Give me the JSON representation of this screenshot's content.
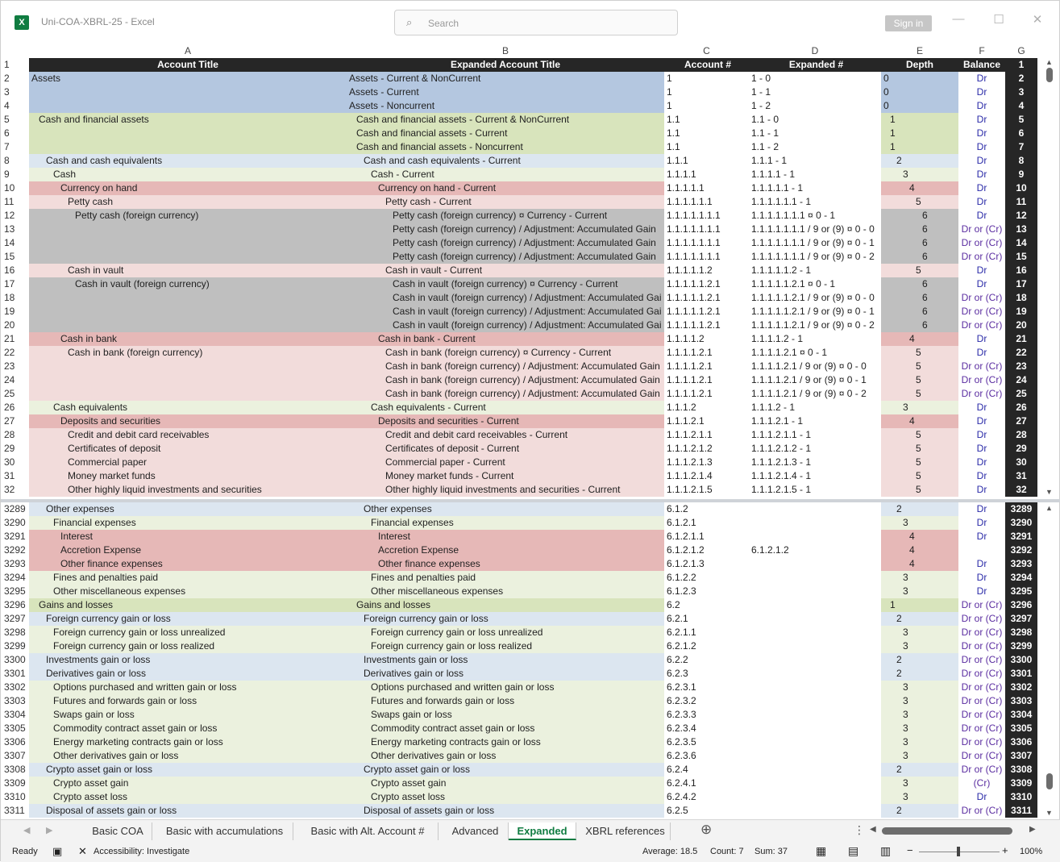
{
  "window": {
    "title": "Uni-COA-XBRL-25  -  Excel",
    "search_placeholder": "Search",
    "signin": "Sign in",
    "min": "—",
    "max": "☐",
    "close": "✕"
  },
  "col_letters": [
    "A",
    "B",
    "C",
    "D",
    "E",
    "F",
    "G"
  ],
  "headers": {
    "a": "Account Title",
    "b": "Expanded Account Title",
    "c": "Account #",
    "d": "Expanded #",
    "e": "Depth",
    "f": "Balance",
    "g": "1"
  },
  "palette": {
    "blue": "#b4c7e0",
    "green": "#d8e4bc",
    "lightblue": "#dce6f0",
    "lightgreen": "#ebf1de",
    "rose": "#e6b8b7",
    "pink": "#f2dcdb",
    "gray": "#bfbfbf"
  },
  "rows_top": [
    {
      "n": "2",
      "a": "Assets",
      "b": "Assets - Current & NonCurrent",
      "c": "1",
      "d": "1 - 0",
      "e": "0",
      "f": "Dr",
      "g": "2",
      "bg": "blue",
      "lvl": 0
    },
    {
      "n": "3",
      "a": "",
      "b": "Assets - Current",
      "c": "1",
      "d": "1 - 1",
      "e": "0",
      "f": "Dr",
      "g": "3",
      "bg": "blue",
      "lvl": 0
    },
    {
      "n": "4",
      "a": "",
      "b": "Assets - Noncurrent",
      "c": "1",
      "d": "1 - 2",
      "e": "0",
      "f": "Dr",
      "g": "4",
      "bg": "blue",
      "lvl": 0
    },
    {
      "n": "5",
      "a": "Cash and financial assets",
      "b": "Cash and financial assets - Current & NonCurrent",
      "c": "1.1",
      "d": "1.1 - 0",
      "e": "1",
      "f": "Dr",
      "g": "5",
      "bg": "green",
      "lvl": 1
    },
    {
      "n": "6",
      "a": "",
      "b": "Cash and financial assets - Current",
      "c": "1.1",
      "d": "1.1 - 1",
      "e": "1",
      "f": "Dr",
      "g": "6",
      "bg": "green",
      "lvl": 1
    },
    {
      "n": "7",
      "a": "",
      "b": "Cash and financial assets - Noncurrent",
      "c": "1.1",
      "d": "1.1 - 2",
      "e": "1",
      "f": "Dr",
      "g": "7",
      "bg": "green",
      "lvl": 1
    },
    {
      "n": "8",
      "a": "Cash and cash equivalents",
      "b": "Cash and cash equivalents - Current",
      "c": "1.1.1",
      "d": "1.1.1 - 1",
      "e": "2",
      "f": "Dr",
      "g": "8",
      "bg": "lightblue",
      "lvl": 2
    },
    {
      "n": "9",
      "a": "Cash",
      "b": "Cash - Current",
      "c": "1.1.1.1",
      "d": "1.1.1.1 - 1",
      "e": "3",
      "f": "Dr",
      "g": "9",
      "bg": "lightgreen",
      "lvl": 3
    },
    {
      "n": "10",
      "a": "Currency on hand",
      "b": "Currency on hand - Current",
      "c": "1.1.1.1.1",
      "d": "1.1.1.1.1 - 1",
      "e": "4",
      "f": "Dr",
      "g": "10",
      "bg": "rose",
      "lvl": 4
    },
    {
      "n": "11",
      "a": "Petty cash",
      "b": "Petty cash - Current",
      "c": "1.1.1.1.1.1",
      "d": "1.1.1.1.1.1 - 1",
      "e": "5",
      "f": "Dr",
      "g": "11",
      "bg": "pink",
      "lvl": 5
    },
    {
      "n": "12",
      "a": "Petty cash (foreign currency)",
      "b": "Petty cash (foreign currency) ¤ Currency - Current",
      "c": "1.1.1.1.1.1.1",
      "d": "1.1.1.1.1.1.1 ¤ 0 - 1",
      "e": "6",
      "f": "Dr",
      "g": "12",
      "bg": "gray",
      "lvl": 6
    },
    {
      "n": "13",
      "a": "",
      "b": "Petty cash (foreign currency) / Adjustment: Accumulated Gain",
      "c": "1.1.1.1.1.1.1",
      "d": "1.1.1.1.1.1.1 / 9 or (9) ¤ 0 - 0",
      "e": "6",
      "f": "Dr or (Cr)",
      "g": "13",
      "bg": "gray",
      "lvl": 6
    },
    {
      "n": "14",
      "a": "",
      "b": "Petty cash (foreign currency) / Adjustment: Accumulated Gain",
      "c": "1.1.1.1.1.1.1",
      "d": "1.1.1.1.1.1.1 / 9 or (9) ¤ 0 - 1",
      "e": "6",
      "f": "Dr or (Cr)",
      "g": "14",
      "bg": "gray",
      "lvl": 6
    },
    {
      "n": "15",
      "a": "",
      "b": "Petty cash (foreign currency) / Adjustment: Accumulated Gain",
      "c": "1.1.1.1.1.1.1",
      "d": "1.1.1.1.1.1.1 / 9 or (9) ¤ 0 - 2",
      "e": "6",
      "f": "Dr or (Cr)",
      "g": "15",
      "bg": "gray",
      "lvl": 6
    },
    {
      "n": "16",
      "a": "Cash in vault",
      "b": "Cash in vault - Current",
      "c": "1.1.1.1.1.2",
      "d": "1.1.1.1.1.2 - 1",
      "e": "5",
      "f": "Dr",
      "g": "16",
      "bg": "pink",
      "lvl": 5
    },
    {
      "n": "17",
      "a": "Cash in vault (foreign currency)",
      "b": "Cash in vault (foreign currency) ¤ Currency - Current",
      "c": "1.1.1.1.1.2.1",
      "d": "1.1.1.1.1.2.1 ¤ 0 - 1",
      "e": "6",
      "f": "Dr",
      "g": "17",
      "bg": "gray",
      "lvl": 6
    },
    {
      "n": "18",
      "a": "",
      "b": "Cash in vault (foreign currency) / Adjustment: Accumulated Gai",
      "c": "1.1.1.1.1.2.1",
      "d": "1.1.1.1.1.2.1 / 9 or (9) ¤ 0 - 0",
      "e": "6",
      "f": "Dr or (Cr)",
      "g": "18",
      "bg": "gray",
      "lvl": 6
    },
    {
      "n": "19",
      "a": "",
      "b": "Cash in vault (foreign currency) / Adjustment: Accumulated Gai",
      "c": "1.1.1.1.1.2.1",
      "d": "1.1.1.1.1.2.1 / 9 or (9) ¤ 0 - 1",
      "e": "6",
      "f": "Dr or (Cr)",
      "g": "19",
      "bg": "gray",
      "lvl": 6
    },
    {
      "n": "20",
      "a": "",
      "b": "Cash in vault (foreign currency) / Adjustment: Accumulated Gai",
      "c": "1.1.1.1.1.2.1",
      "d": "1.1.1.1.1.2.1 / 9 or (9) ¤ 0 - 2",
      "e": "6",
      "f": "Dr or (Cr)",
      "g": "20",
      "bg": "gray",
      "lvl": 6
    },
    {
      "n": "21",
      "a": "Cash in bank",
      "b": "Cash in bank - Current",
      "c": "1.1.1.1.2",
      "d": "1.1.1.1.2 - 1",
      "e": "4",
      "f": "Dr",
      "g": "21",
      "bg": "rose",
      "lvl": 4
    },
    {
      "n": "22",
      "a": "Cash in bank (foreign currency)",
      "b": "Cash in bank (foreign currency) ¤ Currency - Current",
      "c": "1.1.1.1.2.1",
      "d": "1.1.1.1.2.1 ¤ 0 - 1",
      "e": "5",
      "f": "Dr",
      "g": "22",
      "bg": "pink",
      "lvl": 5
    },
    {
      "n": "23",
      "a": "",
      "b": "Cash in bank (foreign currency) / Adjustment: Accumulated Gain",
      "c": "1.1.1.1.2.1",
      "d": "1.1.1.1.2.1 / 9 or (9) ¤ 0 - 0",
      "e": "5",
      "f": "Dr or (Cr)",
      "g": "23",
      "bg": "pink",
      "lvl": 5
    },
    {
      "n": "24",
      "a": "",
      "b": "Cash in bank (foreign currency) / Adjustment: Accumulated Gain",
      "c": "1.1.1.1.2.1",
      "d": "1.1.1.1.2.1 / 9 or (9) ¤ 0 - 1",
      "e": "5",
      "f": "Dr or (Cr)",
      "g": "24",
      "bg": "pink",
      "lvl": 5
    },
    {
      "n": "25",
      "a": "",
      "b": "Cash in bank (foreign currency) / Adjustment: Accumulated Gain",
      "c": "1.1.1.1.2.1",
      "d": "1.1.1.1.2.1 / 9 or (9) ¤ 0 - 2",
      "e": "5",
      "f": "Dr or (Cr)",
      "g": "25",
      "bg": "pink",
      "lvl": 5
    },
    {
      "n": "26",
      "a": "Cash equivalents",
      "b": "Cash equivalents - Current",
      "c": "1.1.1.2",
      "d": "1.1.1.2 - 1",
      "e": "3",
      "f": "Dr",
      "g": "26",
      "bg": "lightgreen",
      "lvl": 3
    },
    {
      "n": "27",
      "a": "Deposits and securities",
      "b": "Deposits and securities - Current",
      "c": "1.1.1.2.1",
      "d": "1.1.1.2.1 - 1",
      "e": "4",
      "f": "Dr",
      "g": "27",
      "bg": "rose",
      "lvl": 4
    },
    {
      "n": "28",
      "a": "Credit and debit card receivables",
      "b": "Credit and debit card receivables - Current",
      "c": "1.1.1.2.1.1",
      "d": "1.1.1.2.1.1 - 1",
      "e": "5",
      "f": "Dr",
      "g": "28",
      "bg": "pink",
      "lvl": 5
    },
    {
      "n": "29",
      "a": "Certificates of deposit",
      "b": "Certificates of deposit - Current",
      "c": "1.1.1.2.1.2",
      "d": "1.1.1.2.1.2 - 1",
      "e": "5",
      "f": "Dr",
      "g": "29",
      "bg": "pink",
      "lvl": 5
    },
    {
      "n": "30",
      "a": "Commercial paper",
      "b": "Commercial paper - Current",
      "c": "1.1.1.2.1.3",
      "d": "1.1.1.2.1.3 - 1",
      "e": "5",
      "f": "Dr",
      "g": "30",
      "bg": "pink",
      "lvl": 5
    },
    {
      "n": "31",
      "a": "Money market funds",
      "b": "Money market funds - Current",
      "c": "1.1.1.2.1.4",
      "d": "1.1.1.2.1.4 - 1",
      "e": "5",
      "f": "Dr",
      "g": "31",
      "bg": "pink",
      "lvl": 5
    },
    {
      "n": "32",
      "a": "Other highly liquid investments and securities",
      "b": "Other highly liquid investments and securities - Current",
      "c": "1.1.1.2.1.5",
      "d": "1.1.1.2.1.5 - 1",
      "e": "5",
      "f": "Dr",
      "g": "32",
      "bg": "pink",
      "lvl": 5
    }
  ],
  "rows_bottom": [
    {
      "n": "3289",
      "a": "Other expenses",
      "b": "Other expenses",
      "c": "6.1.2",
      "d": "",
      "e": "2",
      "f": "Dr",
      "g": "3289",
      "bg": "lightblue",
      "lvl": 2
    },
    {
      "n": "3290",
      "a": "Financial expenses",
      "b": "Financial expenses",
      "c": "6.1.2.1",
      "d": "",
      "e": "3",
      "f": "Dr",
      "g": "3290",
      "bg": "lightgreen",
      "lvl": 3
    },
    {
      "n": "3291",
      "a": "Interest",
      "b": "Interest",
      "c": "6.1.2.1.1",
      "d": "",
      "e": "4",
      "f": "Dr",
      "g": "3291",
      "bg": "rose",
      "lvl": 4
    },
    {
      "n": "3292",
      "a": "Accretion Expense",
      "b": "Accretion Expense",
      "c": "6.1.2.1.2",
      "d": "6.1.2.1.2",
      "e": "4",
      "f": "",
      "g": "3292",
      "bg": "rose",
      "lvl": 4
    },
    {
      "n": "3293",
      "a": "Other finance expenses",
      "b": "Other finance expenses",
      "c": "6.1.2.1.3",
      "d": "",
      "e": "4",
      "f": "Dr",
      "g": "3293",
      "bg": "rose",
      "lvl": 4
    },
    {
      "n": "3294",
      "a": "Fines and penalties paid",
      "b": "Fines and penalties paid",
      "c": "6.1.2.2",
      "d": "",
      "e": "3",
      "f": "Dr",
      "g": "3294",
      "bg": "lightgreen",
      "lvl": 3
    },
    {
      "n": "3295",
      "a": "Other miscellaneous expenses",
      "b": "Other miscellaneous expenses",
      "c": "6.1.2.3",
      "d": "",
      "e": "3",
      "f": "Dr",
      "g": "3295",
      "bg": "lightgreen",
      "lvl": 3
    },
    {
      "n": "3296",
      "a": "Gains and losses",
      "b": "Gains and losses",
      "c": "6.2",
      "d": "",
      "e": "1",
      "f": "Dr or (Cr)",
      "g": "3296",
      "bg": "green",
      "lvl": 1
    },
    {
      "n": "3297",
      "a": "Foreign currency gain or loss",
      "b": "Foreign currency gain or loss",
      "c": "6.2.1",
      "d": "",
      "e": "2",
      "f": "Dr or (Cr)",
      "g": "3297",
      "bg": "lightblue",
      "lvl": 2
    },
    {
      "n": "3298",
      "a": "Foreign currency gain or loss unrealized",
      "b": "Foreign currency gain or loss unrealized",
      "c": "6.2.1.1",
      "d": "",
      "e": "3",
      "f": "Dr or (Cr)",
      "g": "3298",
      "bg": "lightgreen",
      "lvl": 3
    },
    {
      "n": "3299",
      "a": "Foreign currency gain or loss realized",
      "b": "Foreign currency gain or loss realized",
      "c": "6.2.1.2",
      "d": "",
      "e": "3",
      "f": "Dr or (Cr)",
      "g": "3299",
      "bg": "lightgreen",
      "lvl": 3
    },
    {
      "n": "3300",
      "a": "Investments gain or loss",
      "b": "Investments gain or loss",
      "c": "6.2.2",
      "d": "",
      "e": "2",
      "f": "Dr or (Cr)",
      "g": "3300",
      "bg": "lightblue",
      "lvl": 2
    },
    {
      "n": "3301",
      "a": "Derivatives gain or loss",
      "b": "Derivatives gain or loss",
      "c": "6.2.3",
      "d": "",
      "e": "2",
      "f": "Dr or (Cr)",
      "g": "3301",
      "bg": "lightblue",
      "lvl": 2
    },
    {
      "n": "3302",
      "a": "Options purchased and written gain or loss",
      "b": "Options purchased and written gain or loss",
      "c": "6.2.3.1",
      "d": "",
      "e": "3",
      "f": "Dr or (Cr)",
      "g": "3302",
      "bg": "lightgreen",
      "lvl": 3
    },
    {
      "n": "3303",
      "a": "Futures and forwards gain or loss",
      "b": "Futures and forwards gain or loss",
      "c": "6.2.3.2",
      "d": "",
      "e": "3",
      "f": "Dr or (Cr)",
      "g": "3303",
      "bg": "lightgreen",
      "lvl": 3
    },
    {
      "n": "3304",
      "a": "Swaps gain or loss",
      "b": "Swaps gain or loss",
      "c": "6.2.3.3",
      "d": "",
      "e": "3",
      "f": "Dr or (Cr)",
      "g": "3304",
      "bg": "lightgreen",
      "lvl": 3
    },
    {
      "n": "3305",
      "a": "Commodity contract asset gain or loss",
      "b": "Commodity contract asset gain or loss",
      "c": "6.2.3.4",
      "d": "",
      "e": "3",
      "f": "Dr or (Cr)",
      "g": "3305",
      "bg": "lightgreen",
      "lvl": 3
    },
    {
      "n": "3306",
      "a": "Energy marketing contracts gain or loss",
      "b": "Energy marketing contracts gain or loss",
      "c": "6.2.3.5",
      "d": "",
      "e": "3",
      "f": "Dr or (Cr)",
      "g": "3306",
      "bg": "lightgreen",
      "lvl": 3
    },
    {
      "n": "3307",
      "a": "Other derivatives gain or loss",
      "b": "Other derivatives gain or loss",
      "c": "6.2.3.6",
      "d": "",
      "e": "3",
      "f": "Dr or (Cr)",
      "g": "3307",
      "bg": "lightgreen",
      "lvl": 3
    },
    {
      "n": "3308",
      "a": "Crypto asset gain or loss",
      "b": "Crypto asset gain or loss",
      "c": "6.2.4",
      "d": "",
      "e": "2",
      "f": "Dr or (Cr)",
      "g": "3308",
      "bg": "lightblue",
      "lvl": 2
    },
    {
      "n": "3309",
      "a": "Crypto asset gain",
      "b": "Crypto asset gain",
      "c": "6.2.4.1",
      "d": "",
      "e": "3",
      "f": "(Cr)",
      "g": "3309",
      "bg": "lightgreen",
      "lvl": 3
    },
    {
      "n": "3310",
      "a": "Crypto asset loss",
      "b": "Crypto asset loss",
      "c": "6.2.4.2",
      "d": "",
      "e": "3",
      "f": "Dr",
      "g": "3310",
      "bg": "lightgreen",
      "lvl": 3
    },
    {
      "n": "3311",
      "a": "Disposal of assets gain or loss",
      "b": "Disposal of assets gain or loss",
      "c": "6.2.5",
      "d": "",
      "e": "2",
      "f": "Dr or (Cr)",
      "g": "3311",
      "bg": "lightblue",
      "lvl": 2
    }
  ],
  "tabs": [
    "Basic COA",
    "Basic with accumulations",
    "Basic with Alt. Account #",
    "Advanced",
    "Expanded",
    "XBRL references"
  ],
  "active_tab": "Expanded",
  "status": {
    "ready": "Ready",
    "accessibility": "Accessibility: Investigate",
    "average": "Average: 18.5",
    "count": "Count: 7",
    "sum": "Sum: 37",
    "zoom": "100%"
  }
}
